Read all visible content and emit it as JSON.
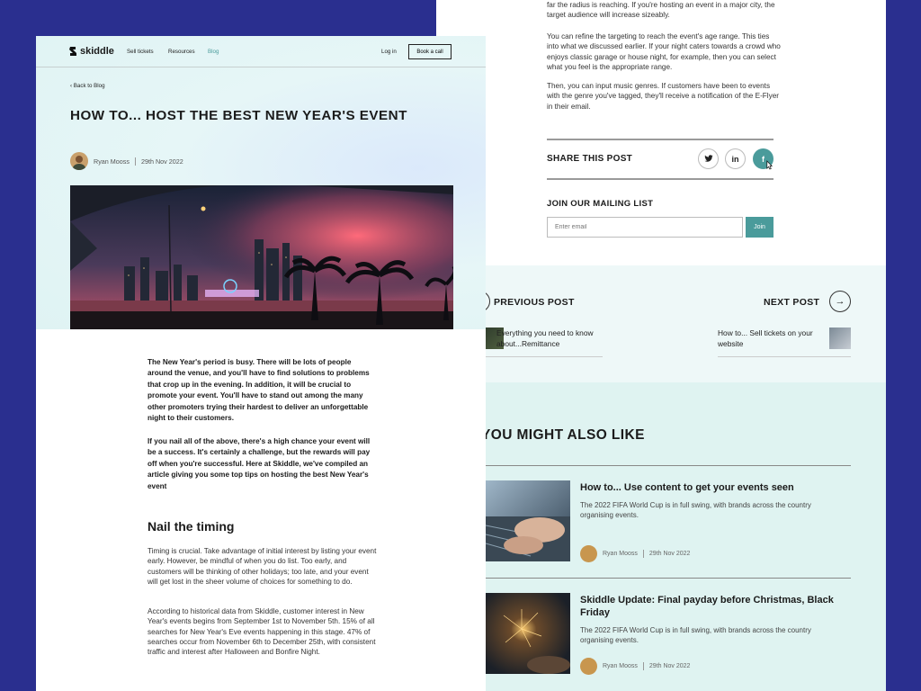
{
  "back_page": {
    "paragraphs": [
      "far the radius is reaching. If you're hosting an event in a major city, the target audience will increase sizeably.",
      "You can refine the targeting to reach the event's age range. This ties into what we discussed earlier. If your night caters towards a crowd who enjoys classic garage or house night, for example, then you can select what you feel is the appropriate range.",
      "Then, you can input music genres. If customers have been to events with the genre you've tagged, they'll receive a notification of the E-Flyer in their email."
    ],
    "share": {
      "title": "SHARE THIS POST",
      "buttons": [
        {
          "name": "twitter",
          "glyph": "🐦︎"
        },
        {
          "name": "linkedin",
          "glyph": "in"
        },
        {
          "name": "facebook",
          "glyph": "f"
        }
      ]
    },
    "mailing": {
      "title": "JOIN OUR MAILING LIST",
      "placeholder": "Enter email",
      "button": "Join"
    },
    "post_nav": {
      "previous_label": "PREVIOUS POST",
      "previous_title": "Everything you need to know about...Remittance",
      "next_label": "NEXT POST",
      "next_title": "How to... Sell tickets on your website"
    },
    "also_like": {
      "title": "YOU MIGHT ALSO LIKE",
      "cards": [
        {
          "title": "How to... Use content to get your events seen",
          "summary": "The 2022 FIFA World Cup is in full swing, with brands across the country organising events.",
          "author": "Ryan Mooss",
          "date": "29th Nov 2022"
        },
        {
          "title": "Skiddle Update: Final payday before Christmas, Black Friday",
          "summary": "The 2022 FIFA World Cup is in full swing, with brands across the country organising events.",
          "author": "Ryan Mooss",
          "date": "29th Nov 2022"
        }
      ]
    }
  },
  "front_page": {
    "header": {
      "logo": "skiddle",
      "nav": [
        "Sell tickets",
        "Resources",
        "Blog"
      ],
      "login": "Log in",
      "cta": "Book a call"
    },
    "back_link": "Back to Blog",
    "article": {
      "title": "How to... host the best New Year's event",
      "author": "Ryan Mooss",
      "date": "29th Nov 2022",
      "intro": [
        "The New Year's period is busy. There will be lots of people around the venue, and you'll have to find solutions to problems that crop up in the evening. In addition, it will be crucial to promote your event. You'll have to stand out among the many other promoters trying their hardest to deliver an unforgettable night to their customers.",
        "If you nail all of the above, there's a high chance your event will be a success. It's certainly a challenge, but the rewards will pay off when you're successful. Here at Skiddle, we've compiled an article giving you some top tips on hosting the best New Year's event"
      ],
      "section_heading": "Nail the timing",
      "section_paragraphs": [
        "Timing is crucial. Take advantage of initial interest by listing your event early. However, be mindful of when you do list. Too early, and customers will be thinking of other holidays; too late, and your event will get lost in the sheer volume of choices for something to do.",
        "According to historical data from Skiddle, customer interest in New Year's events begins from September 1st to November 5th. 15% of all searches for New Year's Eve events happening in this stage. 47% of searches occur from November 6th to December 25th, with consistent traffic and interest after Halloween and Bonfire Night."
      ]
    }
  },
  "colors": {
    "page_background": "#2a2f8f",
    "accent": "#4a9b9b",
    "hero_tint": "#e3f5f5"
  }
}
